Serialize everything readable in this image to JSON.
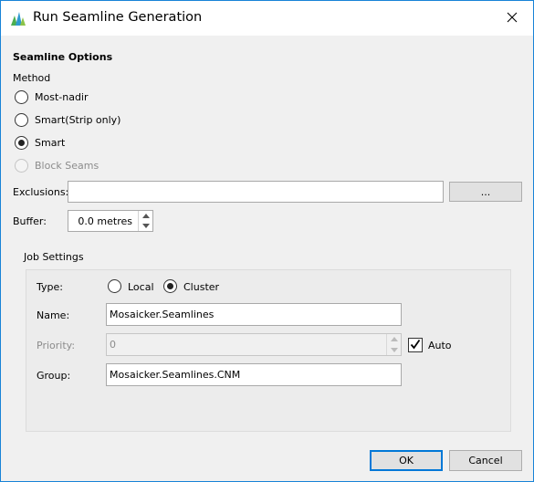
{
  "window": {
    "title": "Run Seamline Generation"
  },
  "seamline": {
    "heading": "Seamline Options",
    "method_label": "Method",
    "methods": [
      {
        "label": "Most-nadir",
        "checked": false,
        "enabled": true
      },
      {
        "label": "Smart(Strip only)",
        "checked": false,
        "enabled": true
      },
      {
        "label": "Smart",
        "checked": true,
        "enabled": true
      },
      {
        "label": "Block Seams",
        "checked": false,
        "enabled": false
      }
    ],
    "exclusions_label": "Exclusions:",
    "exclusions_value": "",
    "browse_label": "...",
    "buffer_label": "Buffer:",
    "buffer_value": "0.0 metres"
  },
  "job": {
    "heading": "Job Settings",
    "type_label": "Type:",
    "type_local": "Local",
    "type_cluster": "Cluster",
    "type_selected": "Cluster",
    "name_label": "Name:",
    "name_value": "Mosaicker.Seamlines",
    "priority_label": "Priority:",
    "priority_value": "0",
    "auto_label": "Auto",
    "auto_checked": true,
    "group_label": "Group:",
    "group_value": "Mosaicker.Seamlines.CNM"
  },
  "footer": {
    "ok_label": "OK",
    "cancel_label": "Cancel"
  },
  "icons": {
    "app": "seamline-app-icon",
    "close": "close-icon",
    "spin_up": "spin-up-icon",
    "spin_down": "spin-down-icon",
    "check": "checkmark-icon"
  }
}
